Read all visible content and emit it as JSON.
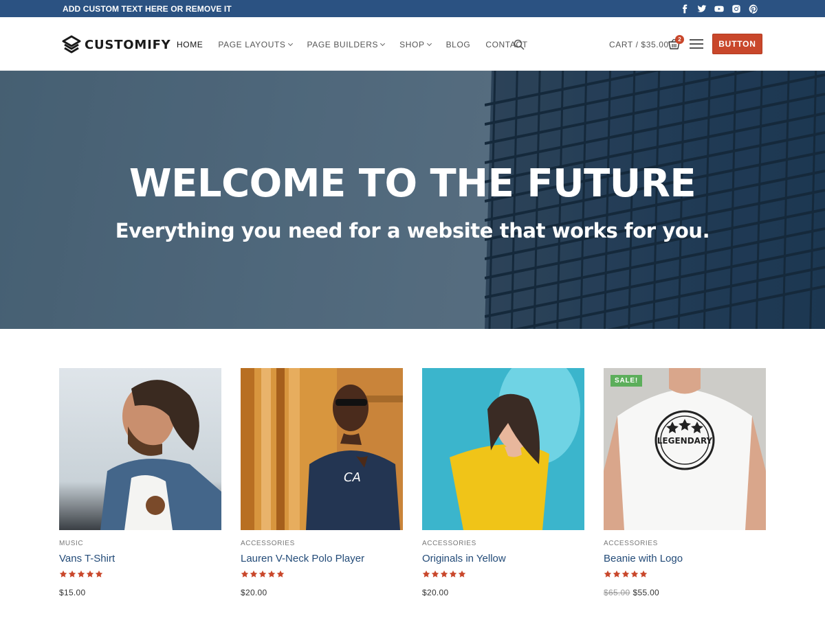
{
  "topbar": {
    "text": "ADD CUSTOM TEXT HERE OR REMOVE IT",
    "socials": [
      "facebook-icon",
      "twitter-icon",
      "youtube-icon",
      "instagram-icon",
      "pinterest-icon"
    ]
  },
  "header": {
    "logo_text": "CUSTOMIFY",
    "nav": [
      {
        "label": "HOME",
        "has_dropdown": false,
        "active": true
      },
      {
        "label": "PAGE LAYOUTS",
        "has_dropdown": true
      },
      {
        "label": "PAGE BUILDERS",
        "has_dropdown": true
      },
      {
        "label": "SHOP",
        "has_dropdown": true
      },
      {
        "label": "BLOG",
        "has_dropdown": false
      },
      {
        "label": "CONTACT",
        "has_dropdown": false
      }
    ],
    "cart_label": "CART / $35.00",
    "cart_count": "2",
    "button_label": "BUTTON"
  },
  "hero": {
    "title": "WELCOME TO THE FUTURE",
    "subtitle": "Everything you need for a website that works for you."
  },
  "products": [
    {
      "category": "MUSIC",
      "title": "Vans T-Shirt",
      "rating": 5,
      "price": "$15.00",
      "old_price": ""
    },
    {
      "category": "ACCESSORIES",
      "title": "Lauren V-Neck Polo Player",
      "rating": 5,
      "price": "$20.00",
      "old_price": ""
    },
    {
      "category": "ACCESSORIES",
      "title": "Originals in Yellow",
      "rating": 5,
      "price": "$20.00",
      "old_price": ""
    },
    {
      "category": "ACCESSORIES",
      "title": "Beanie with Logo",
      "rating": 5,
      "price": "$55.00",
      "old_price": "$65.00",
      "sale_label": "SALE!"
    }
  ],
  "colors": {
    "topbar": "#2b5282",
    "accent": "#c9472b",
    "sale": "#5cae5b",
    "link": "#234b78"
  }
}
